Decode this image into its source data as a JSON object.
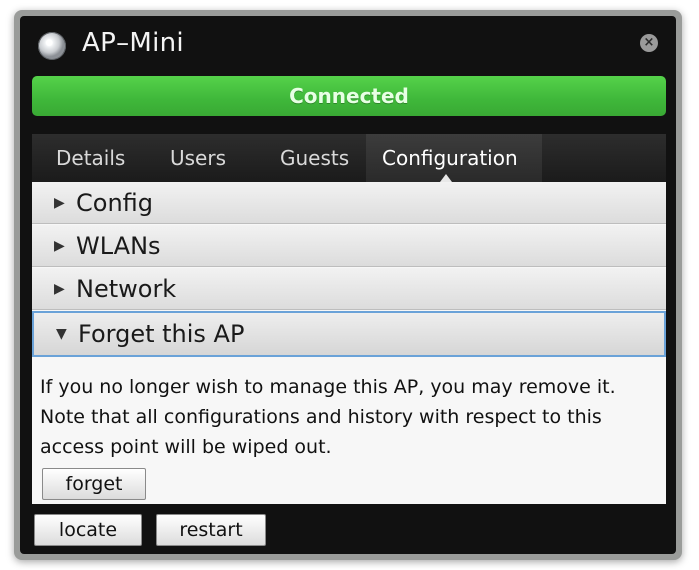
{
  "window": {
    "title": "AP–Mini",
    "close_icon": "close-icon",
    "app_icon": "ap-device-icon"
  },
  "status": {
    "text": "Connected",
    "color": "#46c03f"
  },
  "tabs": [
    {
      "label": "Details"
    },
    {
      "label": "Users"
    },
    {
      "label": "Guests"
    },
    {
      "label": "Configuration",
      "active": true
    }
  ],
  "sections": [
    {
      "label": "Config",
      "expanded": false
    },
    {
      "label": "WLANs",
      "expanded": false
    },
    {
      "label": "Network",
      "expanded": false
    },
    {
      "label": "Forget this AP",
      "expanded": true
    }
  ],
  "forget": {
    "description": "If you no longer wish to manage this AP, you may remove it. Note that all configurations and history with respect to this access point will be wiped out.",
    "button_label": "forget"
  },
  "footer": {
    "locate_label": "locate",
    "restart_label": "restart"
  }
}
